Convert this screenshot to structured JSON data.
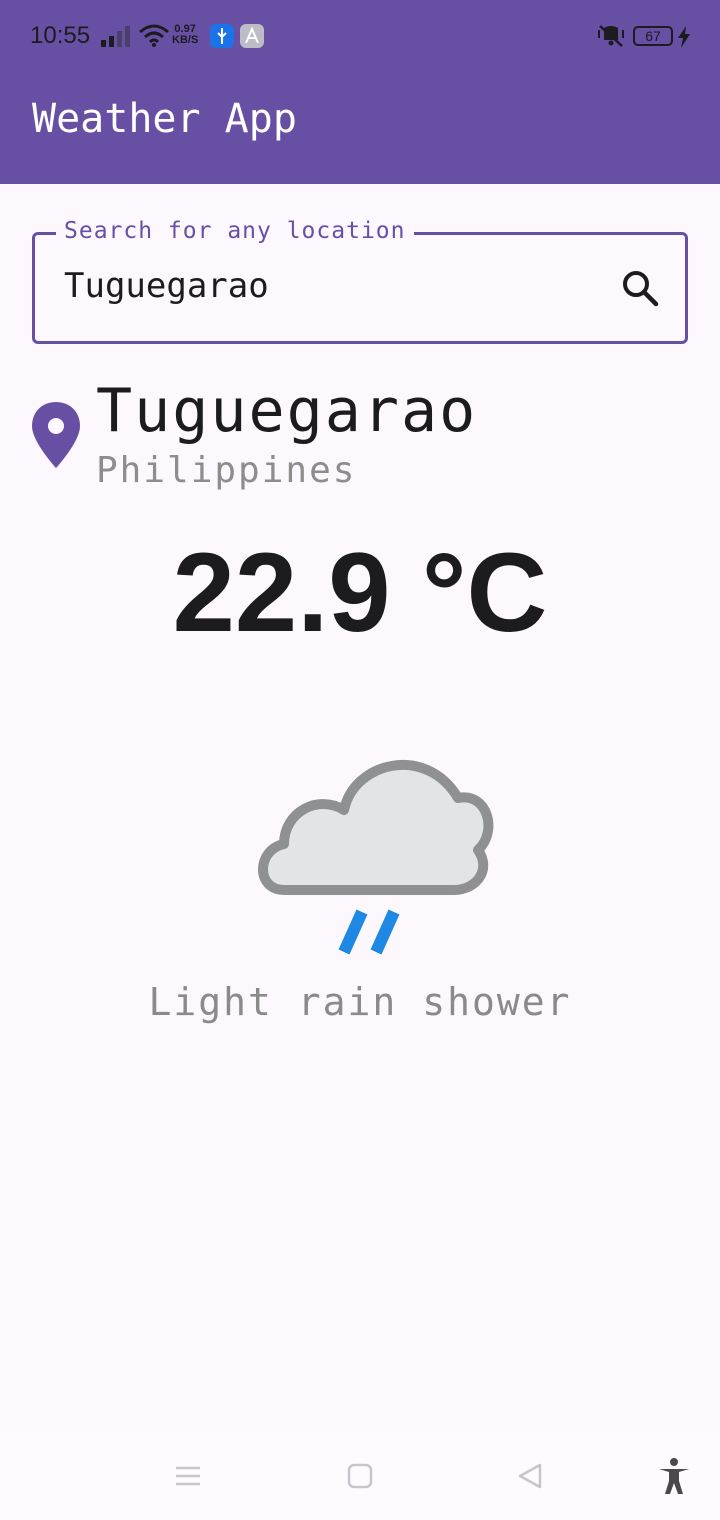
{
  "status_bar": {
    "time": "10:55",
    "speed_value": "0.97",
    "speed_unit": "KB/S",
    "battery": "67"
  },
  "app_bar": {
    "title": "Weather App"
  },
  "search": {
    "label": "Search for any location",
    "value": "Tuguegarao",
    "icon": "search-icon"
  },
  "location": {
    "icon": "location-pin-icon",
    "city": "Tuguegarao",
    "country": "Philippines"
  },
  "weather": {
    "temperature": "22.9 °C",
    "condition": "Light rain shower",
    "icon": "night-cloud-rain-icon"
  },
  "colors": {
    "primary": "#6750a4",
    "background": "#fdf8fd",
    "moon": "#1a73e8",
    "cloud": "#e3e4e6",
    "cloud_outline": "#8e9093",
    "rain": "#1e88e5"
  },
  "nav_bar": {
    "items": [
      "menu-icon",
      "home-icon",
      "back-icon",
      "accessibility-icon"
    ]
  }
}
